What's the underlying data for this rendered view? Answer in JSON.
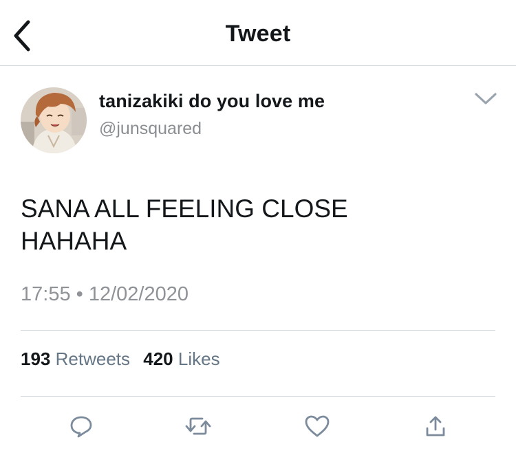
{
  "header": {
    "title": "Tweet"
  },
  "author": {
    "display_name": "tanizakiki do you love me",
    "handle": "@junsquared"
  },
  "tweet": {
    "text_line1": "SANA ALL FEELING CLOSE",
    "text_line2": "HAHAHA",
    "time": "17:55",
    "separator": "•",
    "date": "12/02/2020"
  },
  "stats": {
    "retweets_count": "193",
    "retweets_label": "Retweets",
    "likes_count": "420",
    "likes_label": "Likes"
  },
  "icons": {
    "back": "chevron-left-icon",
    "caret": "chevron-down-icon",
    "reply": "reply-icon",
    "retweet": "retweet-icon",
    "like": "heart-icon",
    "share": "share-icon"
  },
  "colors": {
    "text": "#14171a",
    "secondary": "#657786",
    "icon": "#7b8b9b",
    "divider": "#d6d9dc"
  }
}
